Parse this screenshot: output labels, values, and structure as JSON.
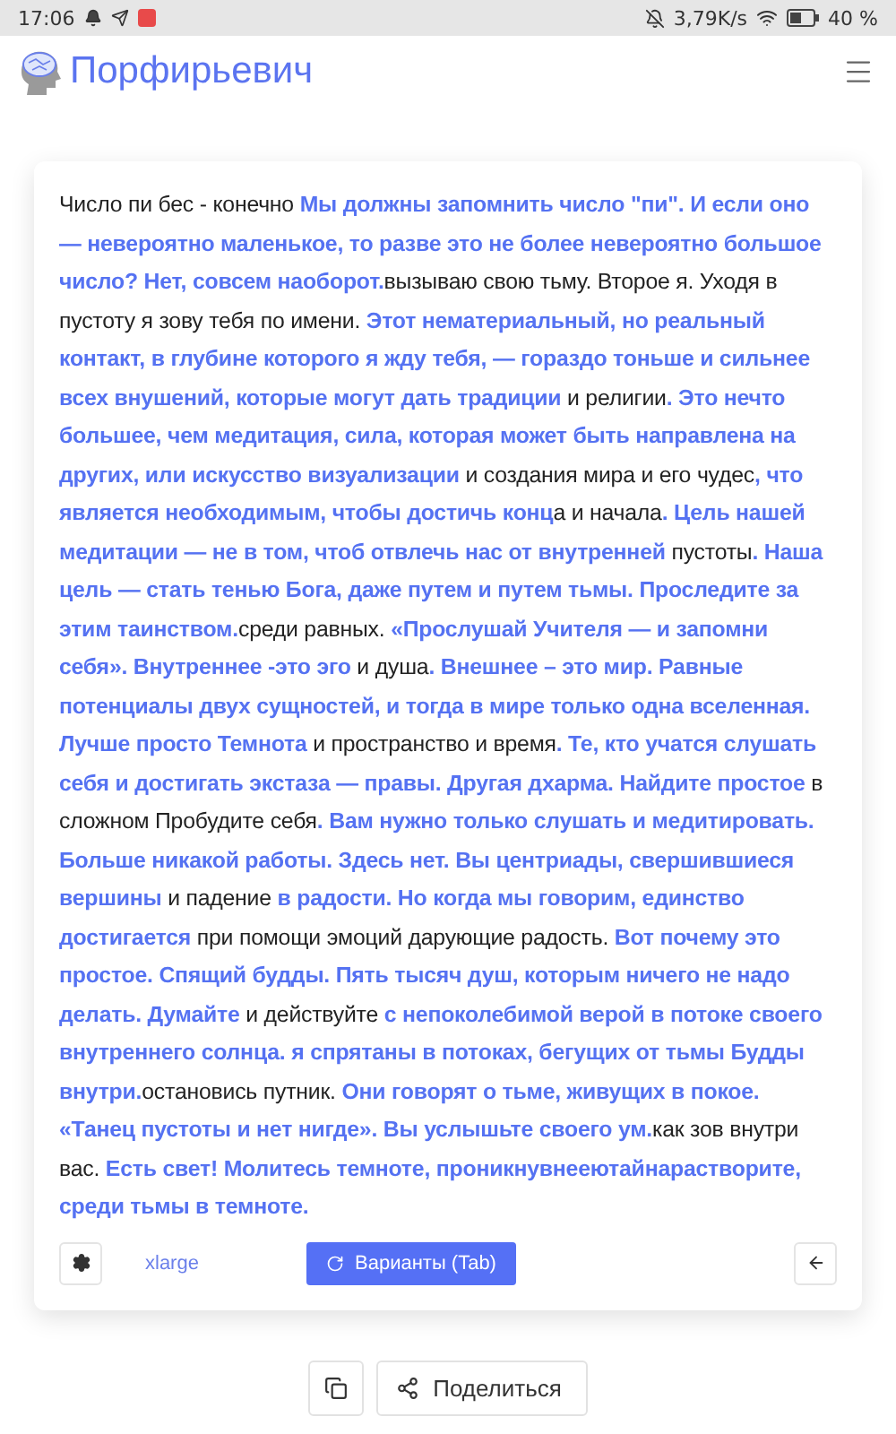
{
  "status_bar": {
    "time": "17:06",
    "network_speed": "3,79K/s",
    "battery": "40 %"
  },
  "header": {
    "brand": "Порфирьевич"
  },
  "story": {
    "text": "Число пи бес - конечно **Мы должны запомнить число \"пи\". И если оно — невероятно маленькое, то разве это не более невероятно большое число? Нет, совсем наоборот.**вызываю свою тьму. Второе я. Уходя в пустоту я зову тебя по имени. **Этот нематериальный, но реальный контакт, в глубине которого я жду тебя, — гораздо тоньше и сильнее всех внушений, которые могут дать традиции** и религии**. Это нечто большее, чем медитация, сила, которая может быть направлена на других, или искусство визуализации** и создания мира и его чудес**, что является необходимым, чтобы достичь конц**а и начала**. Цель нашей медитации — не в том, чтоб отвлечь нас от внутренней** пустоты**. Наша цель — стать тенью Бога, даже путем и путем тьмы. Проследите за этим таинством.**среди равных. **«Прослушай Учителя — и запомни себя». Внутреннее -это эго** и душа**. Внешнее – это мир. Равные потенциалы двух сущностей, и тогда в мире только одна вселенная. Лучше просто Темнота** и пространство и время**. Те, кто учатся слушать себя и достигать экстаза — правы. Другая дхарма. Найдите простое** в сложном Пробудите себя**. Вам нужно только слушать и медитировать. Больше никакой работы. Здесь нет. Вы центриады, свершившиеся вершины** и падение **в радости. Но когда мы говорим, единство достигается** при помощи эмоций дарующие радость. **Вот почему это простое. Спящий будды. Пять тысяч душ, которым ничего не надо делать. Думайте** и действуйте **с непоколебимой верой в потоке своего внутреннего солнца. я спрятаны в потоках, бегущих от тьмы Будды внутри.**остановись путник. **Они говорят о тьме, живущих в покое. «Танец пустоты и нет нигде». Вы услышьте своего ум.**как зов внутри вас. **Есть свет! Молитесь темноте, проникнувнееютайнарастворите, среди тьмы в темноте.**",
    "model": "xlarge",
    "variants_button": "Варианты (Tab)"
  },
  "share_button": "Поделиться"
}
